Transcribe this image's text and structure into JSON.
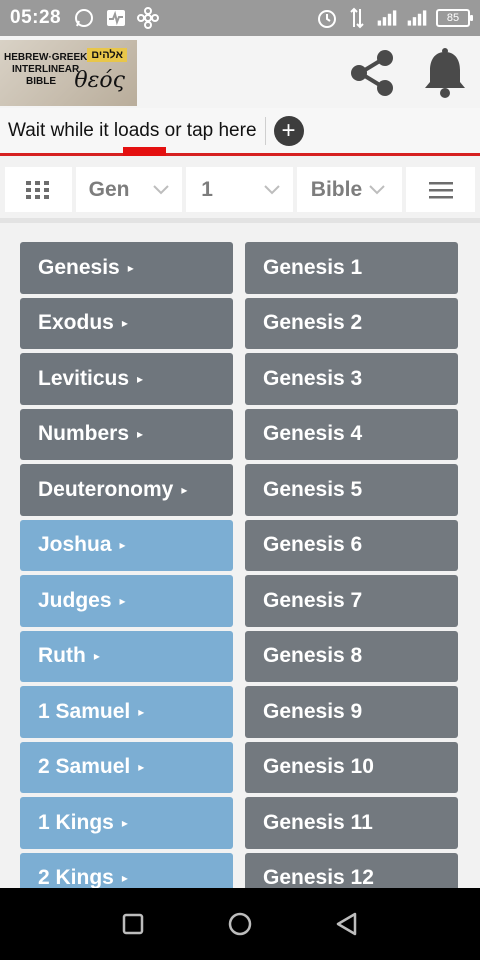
{
  "status": {
    "time": "05:28",
    "battery": "85"
  },
  "header": {
    "logo_line1": "HEBREW·GREEK",
    "logo_line2": "INTERLINEAR",
    "logo_line3": "BIBLE",
    "logo_hebrew": "אלהים",
    "logo_greek": "θεός"
  },
  "banner": {
    "text": "Wait while it loads or tap here",
    "plus": "+"
  },
  "nav": {
    "book": "Gen",
    "chapter": "1",
    "bible": "Bible"
  },
  "books": [
    {
      "label": "Genesis",
      "group": "ot"
    },
    {
      "label": "Exodus",
      "group": "ot"
    },
    {
      "label": "Leviticus",
      "group": "ot"
    },
    {
      "label": "Numbers",
      "group": "ot"
    },
    {
      "label": "Deuteronomy",
      "group": "ot"
    },
    {
      "label": "Joshua",
      "group": "hist"
    },
    {
      "label": "Judges",
      "group": "hist"
    },
    {
      "label": "Ruth",
      "group": "hist"
    },
    {
      "label": "1 Samuel",
      "group": "hist"
    },
    {
      "label": "2 Samuel",
      "group": "hist"
    },
    {
      "label": "1 Kings",
      "group": "hist"
    },
    {
      "label": "2 Kings",
      "group": "hist"
    }
  ],
  "chapters": [
    "Genesis 1",
    "Genesis 2",
    "Genesis 3",
    "Genesis 4",
    "Genesis 5",
    "Genesis 6",
    "Genesis 7",
    "Genesis 8",
    "Genesis 9",
    "Genesis 10",
    "Genesis 11",
    "Genesis 12"
  ],
  "colors": {
    "ot_button": "#6f767d",
    "hist_button": "#7caed3",
    "chapter_button": "#73797f",
    "accent_red": "#d62020"
  }
}
